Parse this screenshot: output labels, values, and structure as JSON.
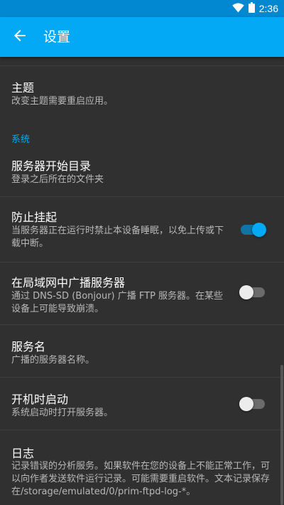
{
  "status_bar": {
    "time": "2:36",
    "icons": [
      "wifi-icon",
      "battery-icon"
    ]
  },
  "app_bar": {
    "title": "设置",
    "back_icon": "arrow-back-icon"
  },
  "colors": {
    "accent": "#03a9f4",
    "status_bar": "#0288d1",
    "background": "#303030"
  },
  "prefs": {
    "theme": {
      "title": "主题",
      "summary": "改变主题需要重启应用。"
    },
    "category_system": "系统",
    "start_dir": {
      "title": "服务器开始目录",
      "summary": "登录之后所在的文件夹"
    },
    "wakelock": {
      "title": "防止挂起",
      "summary": "当服务器正在运行时禁止本设备睡眠，以免上传或下载中断。",
      "enabled": true
    },
    "announce": {
      "title": "在局域网中广播服务器",
      "summary": "通过 DNS-SD (Bonjour) 广播 FTP 服务器。在某些设备上可能导致崩溃。",
      "enabled": false
    },
    "server_name": {
      "title": "服务名",
      "summary": "广播的服务器名称。"
    },
    "boot_start": {
      "title": "开机时启动",
      "summary": "系统启动时打开服务器。",
      "enabled": false
    },
    "logs": {
      "title": "日志",
      "summary": "记录错误的分析服务。如果软件在您的设备上不能正常工作，可以向作者发送软件运行记录。可能需要重启软件。文本记录保存在/storage/emulated/0/prim-ftpd-log-*。"
    }
  }
}
